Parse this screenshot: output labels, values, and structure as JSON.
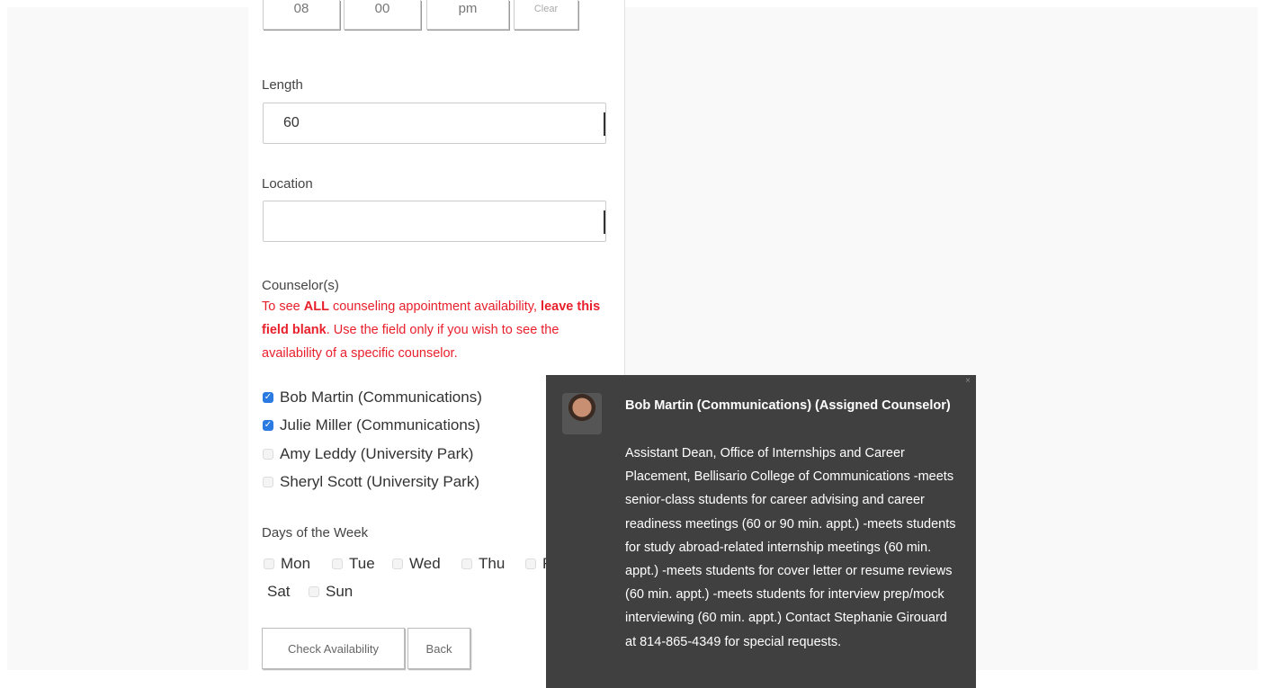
{
  "time_picker": {
    "hour": "08",
    "minute": "00",
    "ampm": "pm",
    "clear_label": "Clear"
  },
  "length": {
    "label": "Length",
    "value": "60"
  },
  "location": {
    "label": "Location",
    "value": ""
  },
  "counselors": {
    "label": "Counselor(s)",
    "warning_prefix": "To see ",
    "warning_bold_1": "ALL",
    "warning_mid": " counseling appointment availability, ",
    "warning_bold_2": "leave this field blank",
    "warning_suffix": ".  Use the field only if you wish to see the availability of a specific counselor.",
    "items": [
      {
        "name": "Bob Martin (Communications)",
        "checked": true
      },
      {
        "name": "Julie Miller (Communications)",
        "checked": true
      },
      {
        "name": "Amy Leddy (University Park)",
        "checked": false
      },
      {
        "name": "Sheryl Scott (University Park)",
        "checked": false
      }
    ]
  },
  "days": {
    "label": "Days of the Week",
    "items": [
      "Mon",
      "Tue",
      "Wed",
      "Thu",
      "F",
      "Sat",
      "Sun"
    ]
  },
  "buttons": {
    "check_availability": "Check Availability",
    "back": "Back"
  },
  "tooltip": {
    "title": "Bob Martin (Communications) (Assigned Counselor)",
    "body": "Assistant Dean, Office of Internships and Career Placement, Bellisario College of Communications -meets senior-class students for career advising and career readiness meetings (60 or 90 min. appt.) -meets students for study abroad-related internship meetings (60 min. appt.) -meets students for cover letter or resume reviews (60 min. appt.) -meets students for interview prep/mock interviewing (60 min. appt.) Contact Stephanie Girouard at 814-865-4349 for special requests."
  }
}
